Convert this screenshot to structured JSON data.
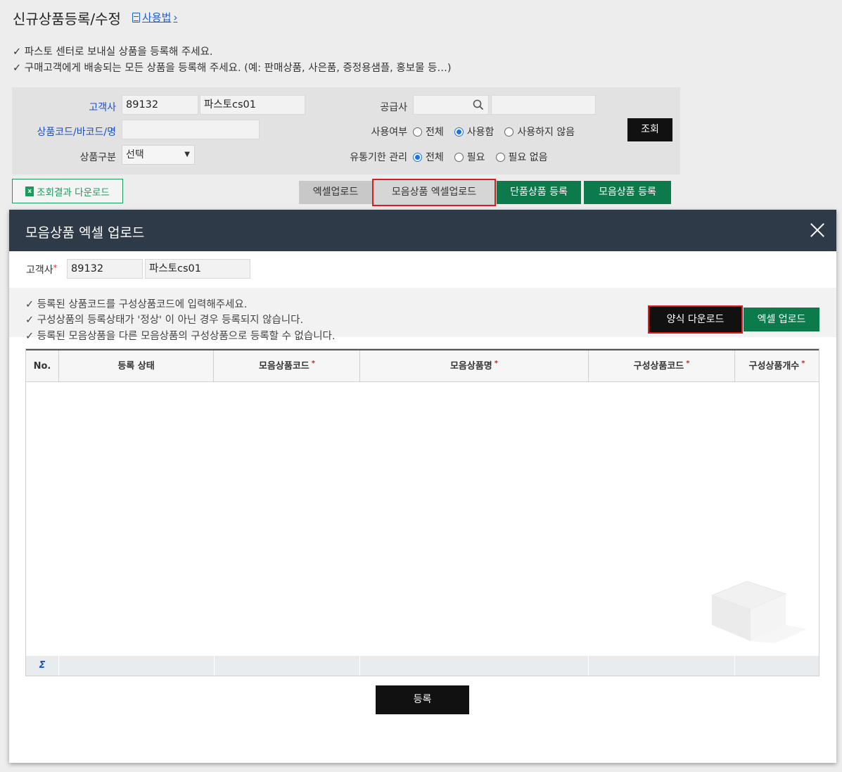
{
  "page": {
    "title": "신규상품등록/수정",
    "help_link": "사용법",
    "notices": [
      "✓ 파스토 센터로 보내실 상품을 등록해 주세요.",
      "✓ 구매고객에게 배송되는 모든 상품을 등록해 주세요. (예: 판매상품, 사은품, 증정용샘플, 홍보물 등…)"
    ]
  },
  "search": {
    "customer_label": "고객사",
    "customer_code": "89132",
    "customer_name": "파스토cs01",
    "product_label": "상품코드/바코드/명",
    "product_value": "",
    "category_label": "상품구분",
    "category_value": "선택",
    "supplier_label": "공급사",
    "usage_label": "사용여부",
    "usage_options": [
      "전체",
      "사용함",
      "사용하지 않음"
    ],
    "usage_selected": "사용함",
    "expiry_label": "유통기한 관리",
    "expiry_options": [
      "전체",
      "필요",
      "필요 없음"
    ],
    "expiry_selected": "전체",
    "search_button": "조회"
  },
  "toolbar": {
    "download_button": "조회결과 다운로드",
    "excel_upload": "엑셀업로드",
    "bundle_excel_upload": "모음상품 엑셀업로드",
    "single_register": "단품상품 등록",
    "bundle_register": "모음상품 등록"
  },
  "modal": {
    "title": "모음상품 엑셀 업로드",
    "customer_label": "고객사",
    "customer_code": "89132",
    "customer_name": "파스토cs01",
    "notes": [
      "✓ 등록된 상품코드를 구성상품코드에 입력해주세요.",
      "✓ 구성상품의 등록상태가 '정상' 이 아닌 경우 등록되지 않습니다.",
      "✓ 등록된 모음상품을 다른 모음상품의 구성상품으로 등록할 수 없습니다."
    ],
    "template_download": "양식 다운로드",
    "excel_upload": "엑셀 업로드",
    "columns": [
      "No.",
      "등록 상태",
      "모음상품코드",
      "모음상품명",
      "구성상품코드",
      "구성상품개수"
    ],
    "required_mark": "*",
    "sum_symbol": "Σ",
    "submit_button": "등록"
  },
  "colors": {
    "header_bg": "#2f3a48",
    "accent_green": "#0c7a4a",
    "highlight_red": "#d81e1e",
    "link_blue": "#1a4fc6"
  }
}
